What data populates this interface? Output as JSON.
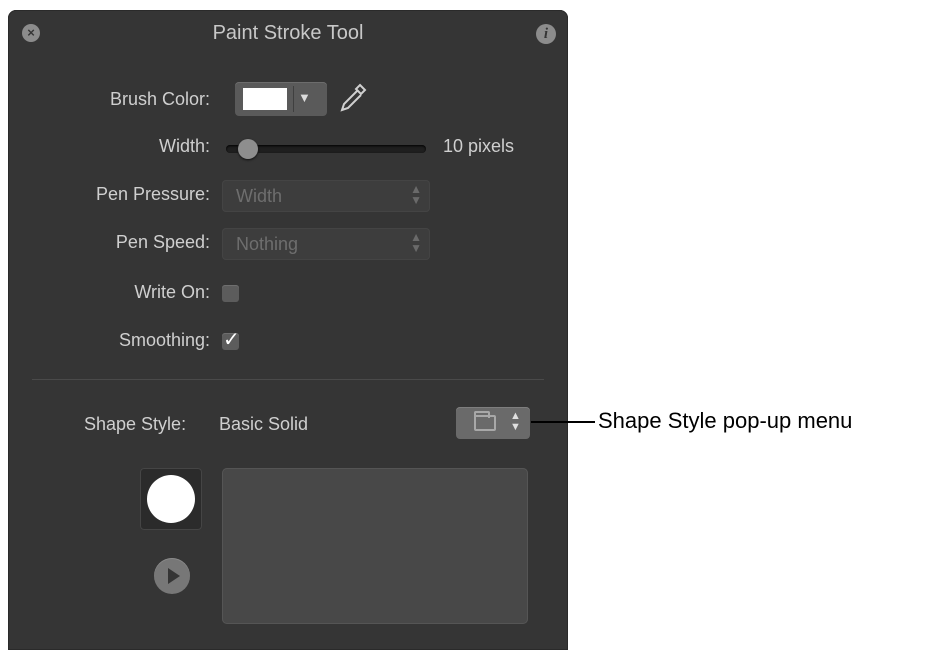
{
  "window": {
    "title": "Paint Stroke Tool",
    "close_glyph": "×",
    "info_glyph": "i"
  },
  "brush_color": {
    "label": "Brush Color:",
    "swatch_color": "#ffffff",
    "dropdown_glyph": "▼",
    "eyedropper_icon": "eyedropper-icon"
  },
  "width": {
    "label": "Width:",
    "value_text": "10 pixels"
  },
  "pen_pressure": {
    "label": "Pen Pressure:",
    "value": "Width"
  },
  "pen_speed": {
    "label": "Pen Speed:",
    "value": "Nothing"
  },
  "write_on": {
    "label": "Write On:",
    "checked": false
  },
  "smoothing": {
    "label": "Smoothing:",
    "checked": true,
    "check_glyph": "✓"
  },
  "shape_style": {
    "label": "Shape Style:",
    "value": "Basic Solid",
    "menu_arrows": "▲▼"
  },
  "preview": {
    "play_icon": "play-icon"
  },
  "callout": {
    "text": "Shape Style pop-up menu"
  },
  "colors": {
    "panel_bg": "#353535",
    "label_text": "#cfcfcf",
    "disabled_text": "#6e6e6e"
  }
}
